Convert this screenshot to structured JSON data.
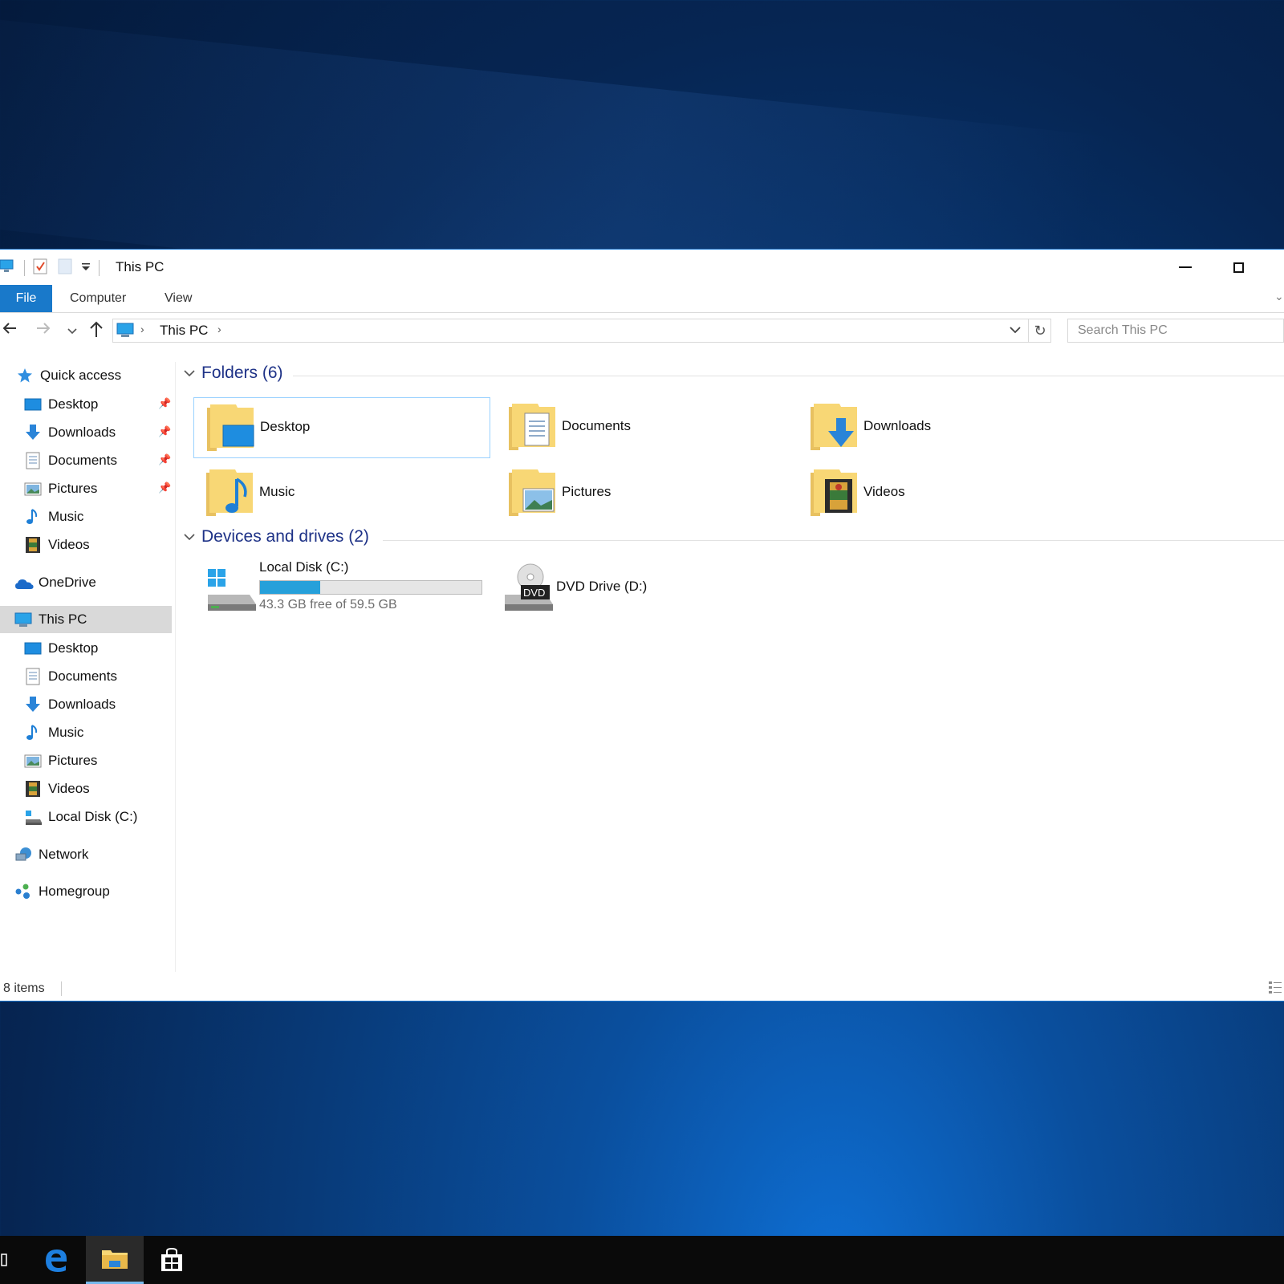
{
  "window": {
    "title": "This PC",
    "ribbon_tabs": [
      "File",
      "Computer",
      "View"
    ]
  },
  "address": {
    "path": "This PC",
    "search_placeholder": "Search This PC"
  },
  "navpane": {
    "quick_access": "Quick access",
    "quick_items": [
      "Desktop",
      "Downloads",
      "Documents",
      "Pictures",
      "Music",
      "Videos"
    ],
    "onedrive": "OneDrive",
    "this_pc": "This PC",
    "pc_items": [
      "Desktop",
      "Documents",
      "Downloads",
      "Music",
      "Pictures",
      "Videos",
      "Local Disk (C:)"
    ],
    "network": "Network",
    "homegroup": "Homegroup"
  },
  "content": {
    "folders_header": "Folders (6)",
    "folders": [
      "Desktop",
      "Documents",
      "Downloads",
      "Music",
      "Pictures",
      "Videos"
    ],
    "devices_header": "Devices and drives (2)",
    "drive_c": {
      "label": "Local Disk (C:)",
      "free_text": "43.3 GB free of 59.5 GB",
      "used_fraction": 0.272
    },
    "drive_d": {
      "label": "DVD Drive (D:)",
      "badge": "DVD"
    }
  },
  "status": {
    "items": "8 items"
  },
  "colors": {
    "accent": "#1979ca",
    "group_header": "#1e3287",
    "drive_fill": "#26a0da"
  }
}
